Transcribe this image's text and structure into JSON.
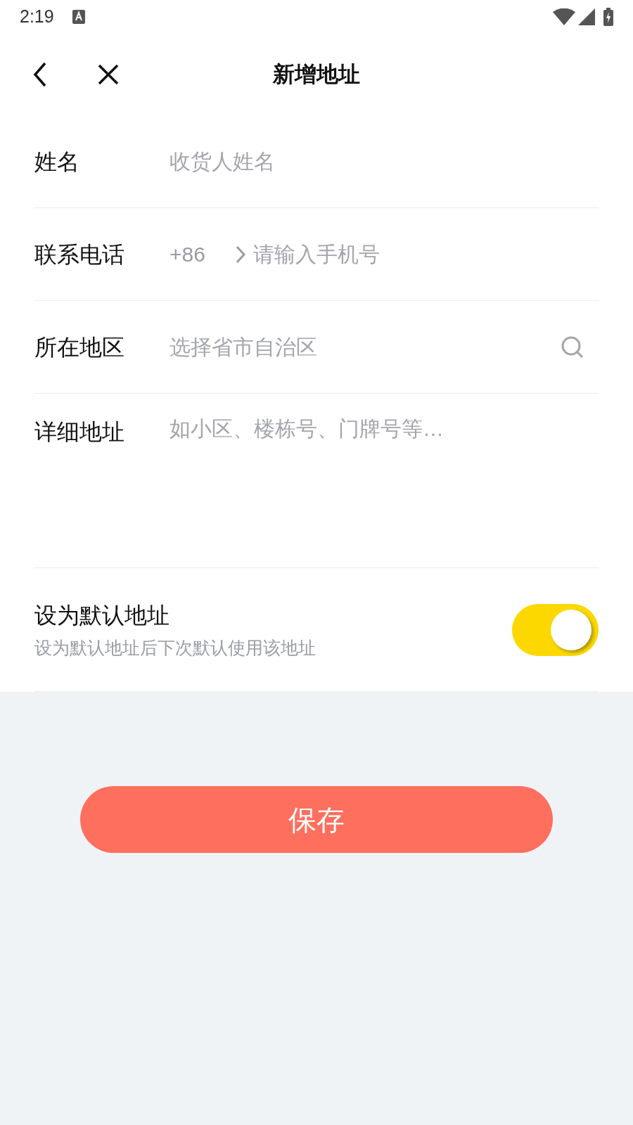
{
  "status_bar": {
    "time": "2:19"
  },
  "header": {
    "title": "新增地址"
  },
  "fields": [
    {
      "kind": "text",
      "label": "姓名",
      "placeholder": "收货人姓名"
    },
    {
      "kind": "phone",
      "label": "联系电话",
      "prefix": "+86",
      "placeholder": "请输入手机号"
    },
    {
      "kind": "region",
      "label": "所在地区",
      "placeholder": "选择省市自治区"
    },
    {
      "kind": "textarea",
      "label": "详细地址",
      "placeholder": "如小区、楼栋号、门牌号等…"
    }
  ],
  "default_address": {
    "title": "设为默认地址",
    "subtitle": "设为默认地址后下次默认使用该地址",
    "on": true
  },
  "save_button": {
    "label": "保存"
  }
}
